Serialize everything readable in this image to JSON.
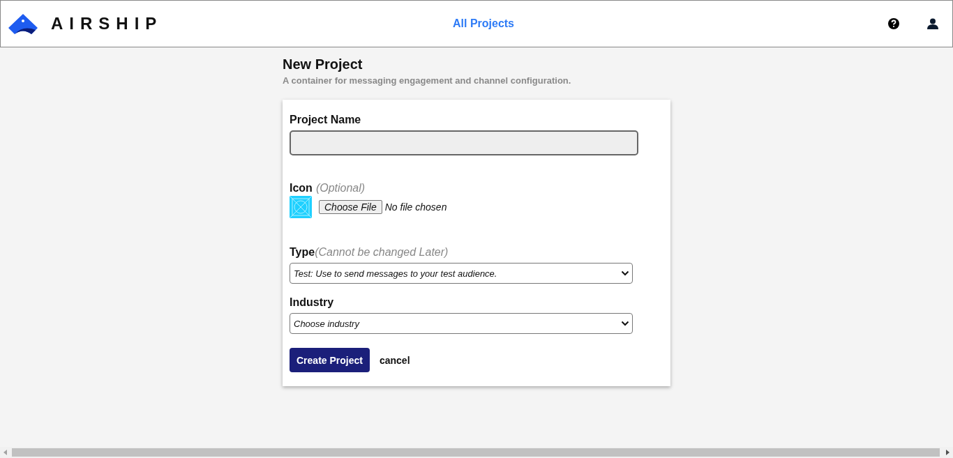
{
  "header": {
    "logo_text": "AIRSHIP",
    "nav_link": "All Projects"
  },
  "page": {
    "title": "New Project",
    "subtitle": "A container for messaging engagement and channel configuration."
  },
  "form": {
    "project_name": {
      "label": "Project Name"
    },
    "icon": {
      "label": "Icon",
      "hint": "(Optional)",
      "button": "Choose File",
      "status": "No file chosen"
    },
    "type": {
      "label": "Type",
      "hint": "(Cannot be changed Later)",
      "value": "Test: Use to send messages to your test audience."
    },
    "industry": {
      "label": "Industry",
      "value": "Choose industry"
    },
    "submit": "Create Project",
    "cancel": "cancel"
  }
}
